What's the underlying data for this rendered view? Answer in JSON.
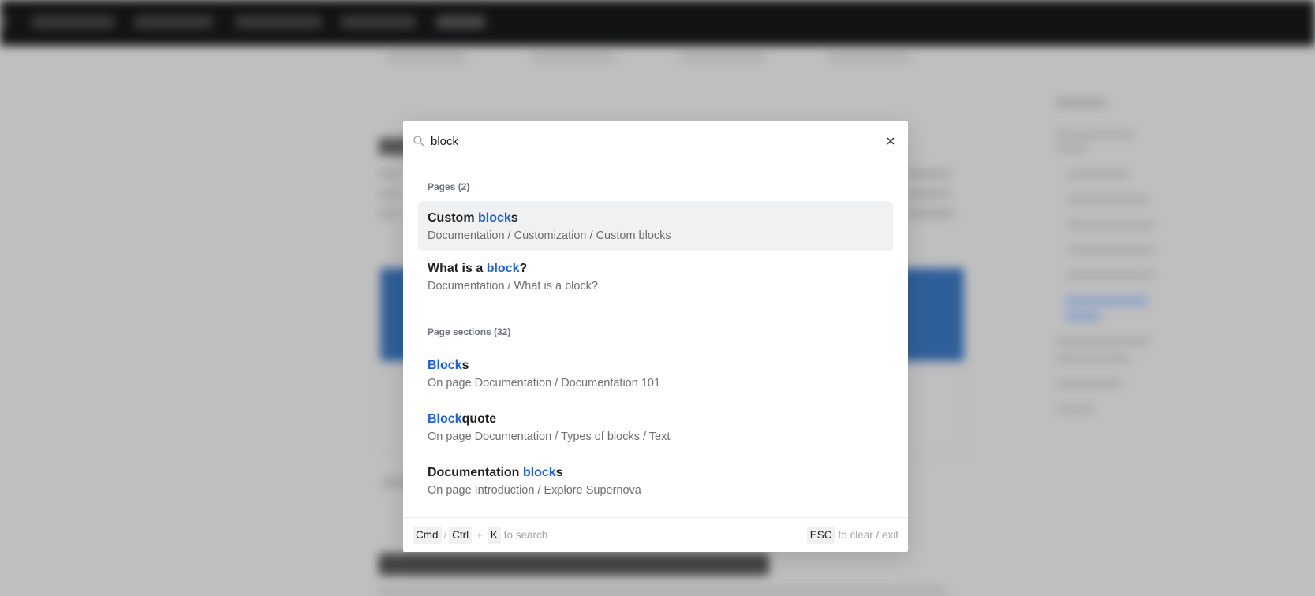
{
  "search": {
    "query": "block",
    "placeholder": ""
  },
  "groups": [
    {
      "title": "Pages (2)",
      "items": [
        {
          "title_parts": [
            {
              "text": "Custom ",
              "hl": false
            },
            {
              "text": "block",
              "hl": true
            },
            {
              "text": "s",
              "hl": false
            }
          ],
          "path": "Documentation / Customization / Custom blocks",
          "active": true
        },
        {
          "title_parts": [
            {
              "text": "What is a ",
              "hl": false
            },
            {
              "text": "block",
              "hl": true
            },
            {
              "text": "?",
              "hl": false
            }
          ],
          "path": "Documentation / What is a block?",
          "active": false
        }
      ]
    },
    {
      "title": "Page sections (32)",
      "items": [
        {
          "title_parts": [
            {
              "text": "Block",
              "hl": true
            },
            {
              "text": "s",
              "hl": false
            }
          ],
          "path": "On page Documentation / Documentation 101",
          "active": false
        },
        {
          "title_parts": [
            {
              "text": "Block",
              "hl": true
            },
            {
              "text": "quote",
              "hl": false
            }
          ],
          "path": "On page Documentation / Types of blocks / Text",
          "active": false
        },
        {
          "title_parts": [
            {
              "text": "Documentation ",
              "hl": false
            },
            {
              "text": "block",
              "hl": true
            },
            {
              "text": "s",
              "hl": false
            }
          ],
          "path": "On page Introduction / Explore Supernova",
          "active": false
        }
      ]
    }
  ],
  "footer": {
    "key_cmd": "Cmd",
    "slash": "/",
    "key_ctrl": "Ctrl",
    "plus": "+",
    "key_k": "K",
    "search_hint": "to search",
    "key_esc": "ESC",
    "esc_hint": "to clear / exit"
  },
  "colors": {
    "highlight": "#1d5ee6",
    "active_row": "#f0f1f3",
    "overlay": "#bfbfbf",
    "topbar": "#121314"
  },
  "icons": {
    "search": "search-icon",
    "close": "close-icon"
  }
}
